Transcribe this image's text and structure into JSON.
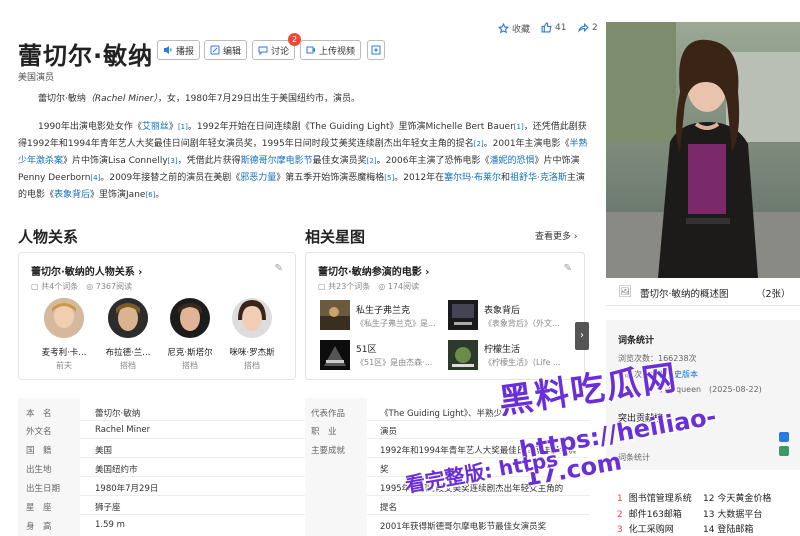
{
  "header": {
    "title": "蕾切尔·敏纳",
    "subtitle": "美国演员",
    "buttons": {
      "read": "播报",
      "edit": "编辑",
      "discuss": "讨论",
      "discuss_count": "2",
      "upload": "上传视频"
    },
    "actions": {
      "collect": "收藏",
      "like_count": "41",
      "share_count": "2"
    }
  },
  "intro": {
    "line1": {
      "name": "蕾切尔·敏纳",
      "latin": "（Rachel Miner）",
      "rest": "，女，1980年7月29日出生于美国纽约市，演员。"
    },
    "p2": [
      "1990年出演电影处女作《",
      "艾丽丝",
      "》",
      "[1]",
      "。1992年开始在日间连续剧《The Guiding Light》里饰演Michelle Bert Bauer",
      "[1]",
      "，还",
      "凭借此剧获得1992年和1994年青年艺人大奖最佳日间剧年轻女演员奖，1995年日间时段艾美奖连续剧杰出年轻女主角的提名",
      "[2]",
      "。2001年主演电影《",
      "半熟少年激杀案",
      "》片中饰演Lisa Connelly",
      "[3]",
      "，凭借此片获得",
      "斯德哥尔摩电影节",
      "最佳女演员奖",
      "[2]",
      "。2006",
      "年主演了恐怖电影《",
      "潘妮的恐惧",
      "》片中饰演Penny Deerborn",
      "[4]",
      "。2009年接替之前的演员在美剧《",
      "邪恶力量",
      "》第五季开始饰演恶",
      "魔梅格",
      "[5]",
      "。2012年在",
      "塞尔玛·布莱尔",
      "和",
      "祖舒华·克洛斯",
      "主演的电影《",
      "表象背后",
      "》里饰演Jane",
      "[6]",
      "。"
    ]
  },
  "relations": {
    "heading": "人物关系",
    "card_title": "蕾切尔·敏纳的人物关系",
    "meta": "共4个词条",
    "views": "7367阅读",
    "people": [
      {
        "name": "麦考利·卡...",
        "role": "前夫"
      },
      {
        "name": "布拉德·兰...",
        "role": "搭档"
      },
      {
        "name": "尼克·斯塔尔",
        "role": "搭档"
      },
      {
        "name": "咪咪·罗杰斯",
        "role": "搭档"
      }
    ]
  },
  "related": {
    "heading": "相关星图",
    "more": "查看更多",
    "card_title": "蕾切尔·敏纳参演的电影",
    "meta": "共23个词条",
    "views": "174阅读",
    "movies": [
      {
        "title": "私生子弗兰克",
        "desc": "《私生子弗兰克》是..."
      },
      {
        "title": "表象背后",
        "desc": "《表象背后》（外文..."
      },
      {
        "title": "51区",
        "desc": "《51区》是由杰森·..."
      },
      {
        "title": "柠檬生活",
        "desc": "《柠檬生活》（Life ..."
      }
    ]
  },
  "basic_info": {
    "left": [
      {
        "label": "本　名",
        "value": "蕾切尔·敏纳"
      },
      {
        "label": "外文名",
        "value": "Rachel Miner"
      },
      {
        "label": "国　籍",
        "value": "美国",
        "link": true
      },
      {
        "label": "出生地",
        "value": "美国纽约市"
      },
      {
        "label": "出生日期",
        "value": "1980年7月29日"
      },
      {
        "label": "星　座",
        "value": "狮子座",
        "link": true
      },
      {
        "label": "身　高",
        "value": "1.59 m"
      }
    ],
    "right": [
      {
        "label": "代表作品",
        "value": "《The Guiding Light》、半熟少..."
      },
      {
        "label": "职　业",
        "value": "演员"
      },
      {
        "label": "主要成就",
        "value": "1992年和1994年青年艺人大奖最佳日间剧年轻女演"
      },
      {
        "label": "",
        "value": "奖"
      },
      {
        "label": "",
        "value": "1995年日间时段艾美奖连续剧杰出年轻女主角的"
      },
      {
        "label": "",
        "value": "提名"
      },
      {
        "label": "",
        "value": "2001年获得斯德哥尔摩电影节最佳女演员奖"
      }
    ]
  },
  "sidebar": {
    "photo_caption": "蕾切尔·敏纳的概述图",
    "photo_count": "（2张）",
    "stats_title": "词条统计",
    "views_label": "浏览次数：166238次",
    "edits_label": "编辑次数：",
    "history_link": "次历史版本",
    "last_edit": "几何queen　(2025-08-22)",
    "special": "突出贡献榜",
    "service": "词条统计",
    "hot": [
      {
        "n": "1",
        "t": "图书馆管理系统"
      },
      {
        "n": "12",
        "t": "今天黄金价格"
      },
      {
        "n": "2",
        "t": "邮件163邮箱"
      },
      {
        "n": "13",
        "t": "大数据平台"
      },
      {
        "n": "3",
        "t": "化工采购网"
      },
      {
        "n": "14",
        "t": "登陆邮箱"
      }
    ]
  },
  "watermark": {
    "line1": "黑料吃瓜网",
    "line2": "https://heiliao-17.com",
    "line3": "看完整版: https"
  }
}
